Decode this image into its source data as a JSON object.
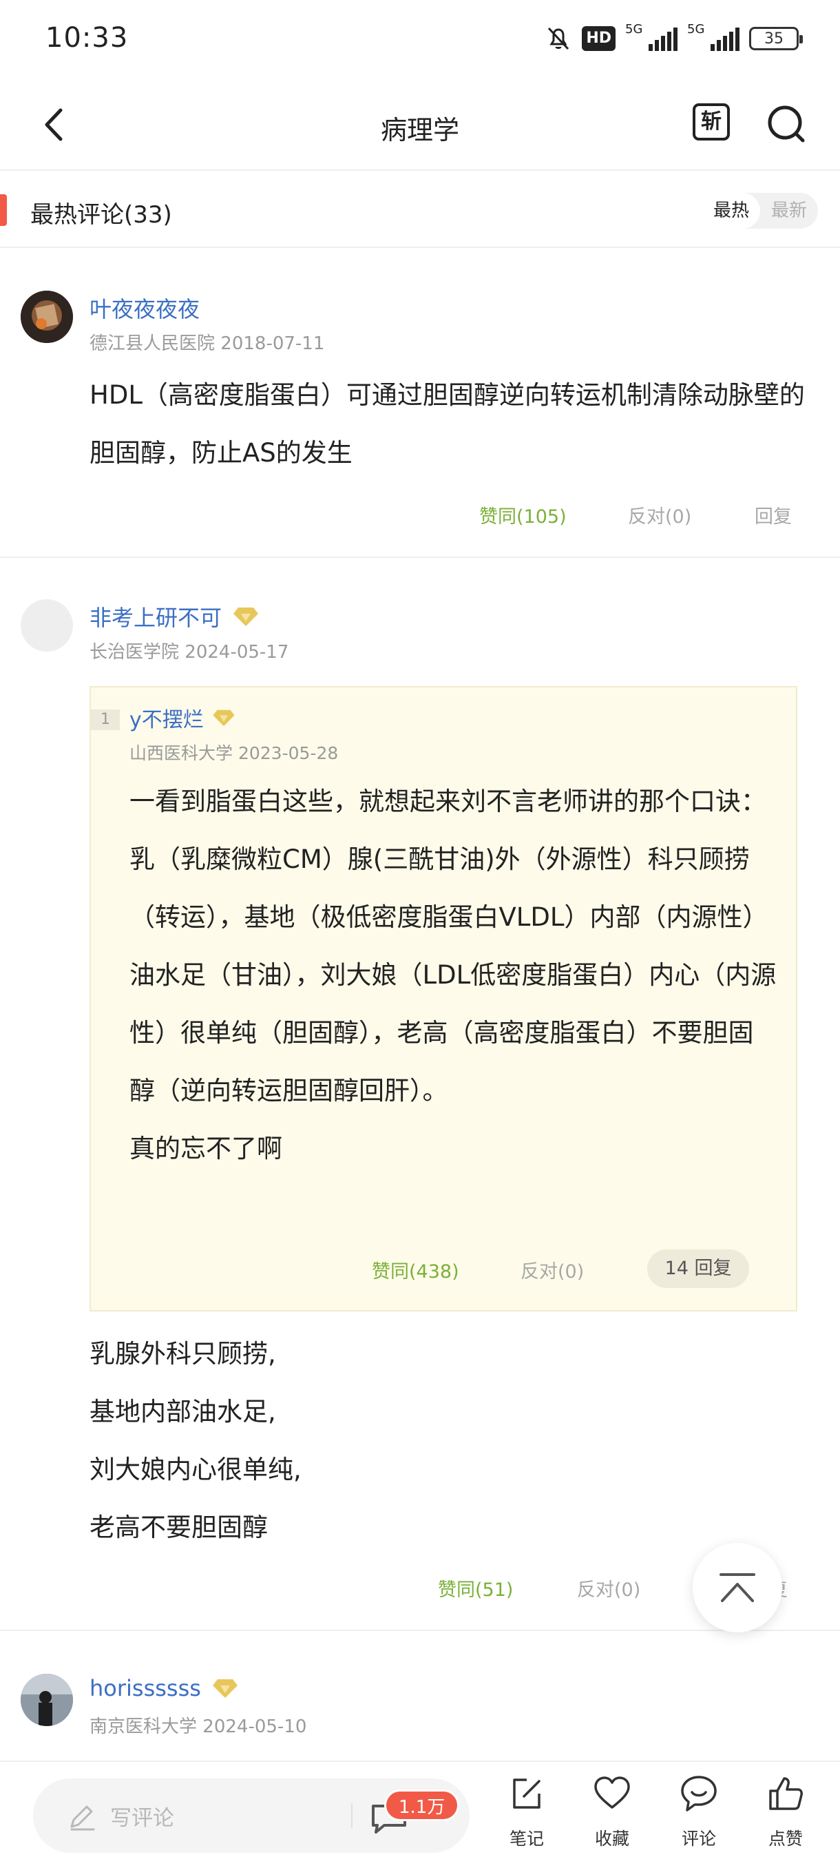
{
  "status": {
    "time": "10:33",
    "hd_label": "HD",
    "net1": "5G",
    "net2": "5G",
    "battery": "35"
  },
  "nav": {
    "title": "病理学",
    "new_icon_char": "斩"
  },
  "section": {
    "title": "最热评论(33)",
    "sort_hot": "最热",
    "sort_new": "最新"
  },
  "comments": [
    {
      "author": "叶夜夜夜夜",
      "hospital": "德江县人民医院",
      "date": "2018-07-11",
      "text": "HDL（高密度脂蛋白）可通过胆固醇逆向转运机制清除动脉壁的胆固醇，防止AS的发生",
      "agree": "赞同(105)",
      "oppose": "反对(0)",
      "reply": "回复"
    },
    {
      "author": "非考上研不可",
      "hospital": "长治医学院",
      "date": "2024-05-17",
      "quote": {
        "index": "1",
        "author": "y不摆烂",
        "hospital": "山西医科大学",
        "date": "2023-05-28",
        "text": "一看到脂蛋白这些，就想起来刘不言老师讲的那个口诀：乳（乳糜微粒CM）腺(三酰甘油)外（外源性）科只顾捞（转运），基地（极低密度脂蛋白VLDL）内部（内源性）油水足（甘油），刘大娘（LDL低密度脂蛋白）内心（内源性）很单纯（胆固醇），老高（高密度脂蛋白）不要胆固醇（逆向转运胆固醇回肝）。\n真的忘不了啊",
        "agree": "赞同(438)",
        "oppose": "反对(0)",
        "replies": "14 回复"
      },
      "text": "乳腺外科只顾捞,\n基地内部油水足,\n刘大娘内心很单纯,\n老高不要胆固醇",
      "agree": "赞同(51)",
      "oppose": "反对(0)",
      "reply": "回复"
    },
    {
      "author": "horissssss",
      "hospital": "南京医科大学",
      "date": "2024-05-10"
    }
  ],
  "bottom": {
    "placeholder": "写评论",
    "comment_count": "1.1万",
    "tabs": [
      "笔记",
      "收藏",
      "评论",
      "点赞"
    ]
  },
  "colors": {
    "accent": "#f15a47",
    "link": "#3b6fc4",
    "agree": "#7bb038",
    "quote_bg": "#fefbea",
    "badge": "#e8c75a"
  }
}
